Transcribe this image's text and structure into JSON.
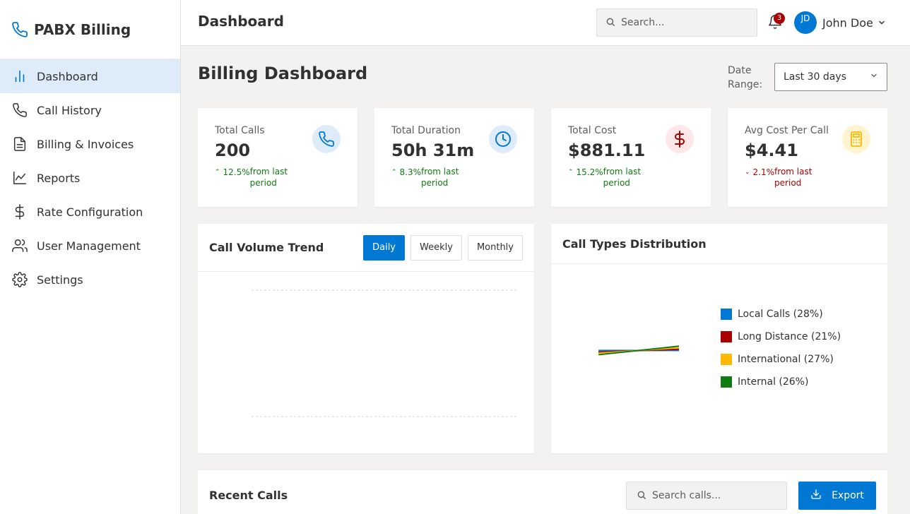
{
  "app": {
    "name": "PABX Billing"
  },
  "sidebar": {
    "items": [
      {
        "label": "Dashboard",
        "icon": "bar-chart-icon",
        "active": true
      },
      {
        "label": "Call History",
        "icon": "phone-icon"
      },
      {
        "label": "Billing & Invoices",
        "icon": "document-icon"
      },
      {
        "label": "Reports",
        "icon": "line-chart-icon"
      },
      {
        "label": "Rate Configuration",
        "icon": "dollar-icon"
      },
      {
        "label": "User Management",
        "icon": "users-icon"
      },
      {
        "label": "Settings",
        "icon": "gear-icon"
      }
    ]
  },
  "header": {
    "title": "Dashboard",
    "search_placeholder": "Search...",
    "notification_count": "3",
    "user": {
      "name": "John Doe",
      "initials": "JD"
    }
  },
  "main": {
    "title": "Billing Dashboard",
    "date_range": {
      "label": "Date Range:",
      "value": "Last 30 days"
    }
  },
  "stats": [
    {
      "label": "Total Calls",
      "value": "200",
      "change": "12.5%",
      "change_text": "from last period",
      "trend": "up",
      "icon": "phone-icon",
      "color": "#0078d4",
      "bg": "#deecf9"
    },
    {
      "label": "Total Duration",
      "value": "50h 31m",
      "change": "8.3%",
      "change_text": "from last period",
      "trend": "up",
      "icon": "clock-icon",
      "color": "#0078d4",
      "bg": "#deecf9"
    },
    {
      "label": "Total Cost",
      "value": "$881.11",
      "change": "15.2%",
      "change_text": "from last period",
      "trend": "up",
      "icon": "dollar-icon",
      "color": "#a80000",
      "bg": "#fde7e9"
    },
    {
      "label": "Avg Cost Per Call",
      "value": "$4.41",
      "change": "2.1%",
      "change_text": "from last period",
      "trend": "down",
      "icon": "calculator-icon",
      "color": "#ffb900",
      "bg": "#fff4ce"
    }
  ],
  "call_volume": {
    "title": "Call Volume Trend",
    "tabs": [
      "Daily",
      "Weekly",
      "Monthly"
    ],
    "active_tab": "Daily"
  },
  "call_types": {
    "title": "Call Types Distribution",
    "legend": [
      {
        "label": "Local Calls (28%)",
        "color": "#0078d4",
        "value": 28
      },
      {
        "label": "Long Distance (21%)",
        "color": "#a80000",
        "value": 21
      },
      {
        "label": "International (27%)",
        "color": "#ffb900",
        "value": 27
      },
      {
        "label": "Internal (26%)",
        "color": "#107c10",
        "value": 26
      }
    ]
  },
  "recent_calls": {
    "title": "Recent Calls",
    "search_placeholder": "Search calls...",
    "export_label": "Export"
  }
}
